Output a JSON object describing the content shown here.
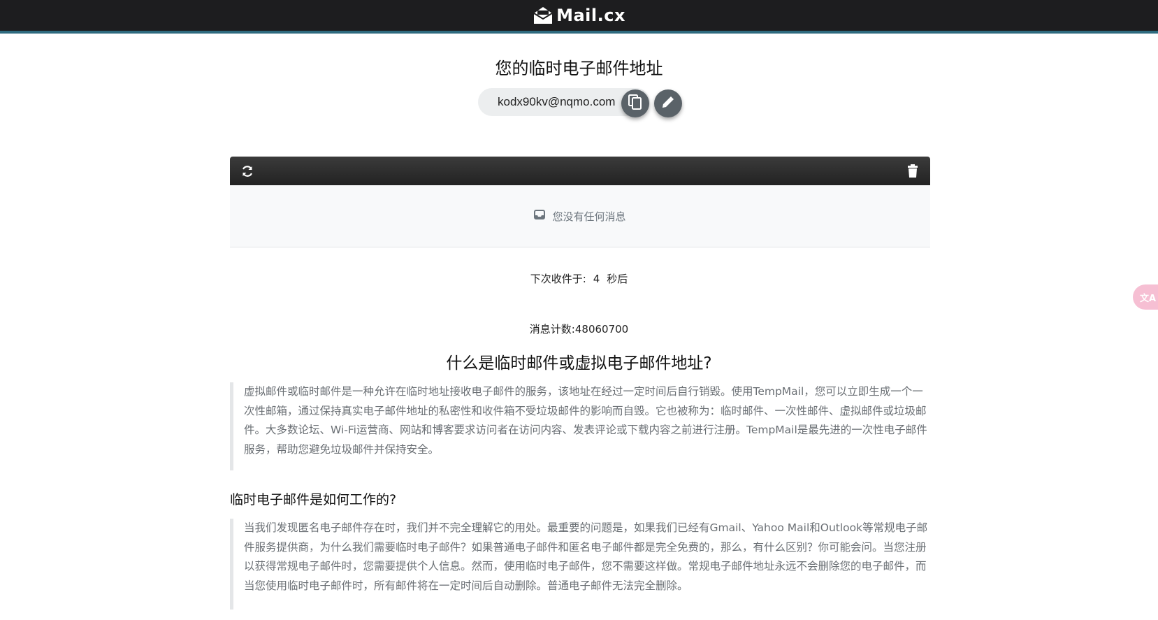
{
  "header": {
    "logo_text": "Mail.cx",
    "logo_icon": "envelope-open-icon",
    "bar_color": "#1d1d1f",
    "accent_color": "#2f6b7f"
  },
  "main": {
    "title": "您的临时电子邮件地址",
    "email": "kodx90kv@nqmo.com",
    "copy_icon": "copy-icon",
    "edit_icon": "pencil-icon"
  },
  "inbox": {
    "refresh_icon": "refresh-icon",
    "delete_icon": "trash-icon",
    "empty_icon": "inbox-icon",
    "empty_text": "您没有任何消息"
  },
  "status": {
    "next_fetch_prefix": "下次收件于:",
    "next_fetch_seconds": "4",
    "next_fetch_suffix": "秒后",
    "message_count": "消息计数:48060700"
  },
  "article": {
    "heading": "什么是临时邮件或虚拟电子邮件地址?",
    "paragraph1": "虚拟邮件或临时邮件是一种允许在临时地址接收电子邮件的服务，该地址在经过一定时间后自行销毁。使用TempMail，您可以立即生成一个一次性邮箱，通过保持真实电子邮件地址的私密性和收件箱不受垃圾邮件的影响而自毁。它也被称为：临时邮件、一次性邮件、虚拟邮件或垃圾邮件。大多数论坛、Wi-Fi运营商、网站和博客要求访问者在访问内容、发表评论或下载内容之前进行注册。TempMail是最先进的一次性电子邮件服务，帮助您避免垃圾邮件并保持安全。",
    "subheading": "临时电子邮件是如何工作的?",
    "paragraph2": "当我们发现匿名电子邮件存在时，我们并不完全理解它的用处。最重要的问题是，如果我们已经有Gmail、Yahoo Mail和Outlook等常规电子邮件服务提供商，为什么我们需要临时电子邮件？如果普通电子邮件和匿名电子邮件都是完全免费的，那么，有什么区别？你可能会问。当您注册以获得常规电子邮件时，您需要提供个人信息。然而，使用临时电子邮件，您不需要这样做。常规电子邮件地址永远不会删除您的电子邮件，而当您使用临时电子邮件时，所有邮件将在一定时间后自动删除。普通电子邮件无法完全删除。"
  },
  "floating": {
    "translate_label": "文A",
    "translate_icon": "translate-icon"
  }
}
